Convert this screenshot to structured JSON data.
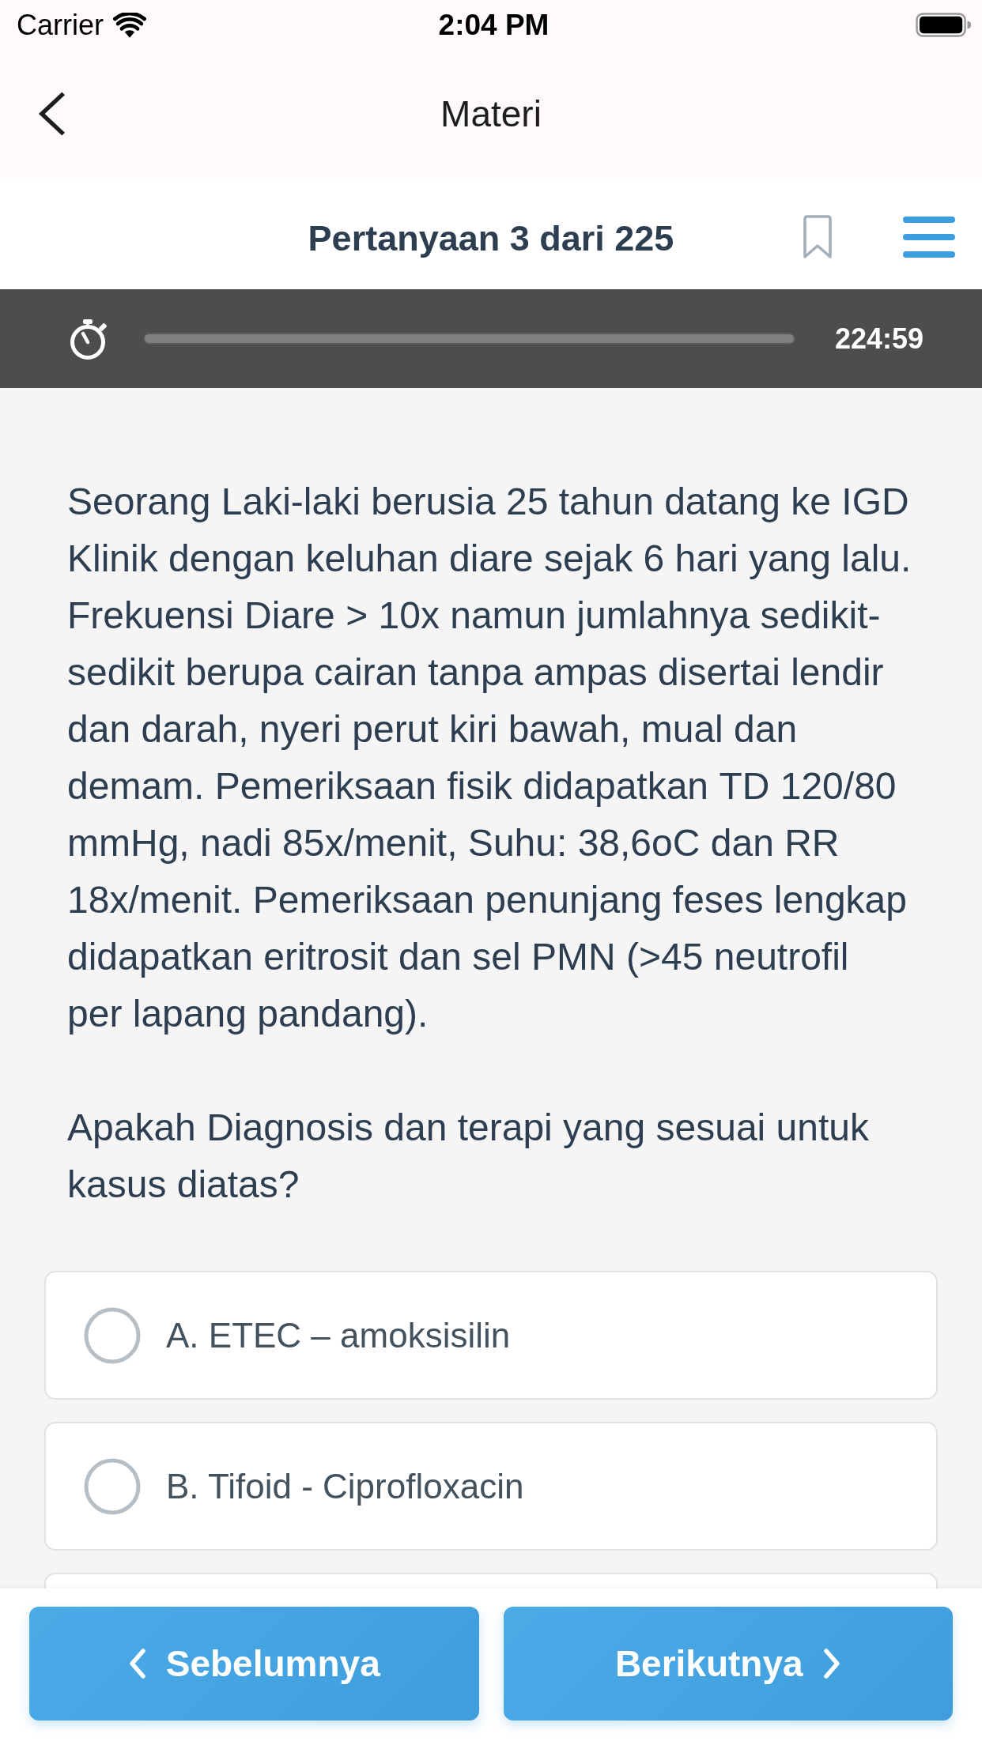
{
  "status_bar": {
    "carrier": "Carrier",
    "time": "2:04 PM"
  },
  "nav_bar": {
    "title": "Materi"
  },
  "question_header": {
    "title": "Pertanyaan 3 dari 225",
    "bookmarked": false
  },
  "timer": {
    "level": 1,
    "time": "224:59"
  },
  "question": {
    "case_text": "Seorang Laki-laki berusia 25 tahun datang ke IGD Klinik dengan keluhan diare sejak 6 hari yang lalu. Frekuensi Diare > 10x namun jumlahnya sedikit-sedikit berupa cairan tanpa ampas disertai lendir dan darah, nyeri perut kiri bawah, mual dan demam. Pemeriksaan fisik didapatkan TD 120/80 mmHg, nadi 85x/menit, Suhu: 38,6oC dan RR 18x/menit. Pemeriksaan penunjang feses lengkap didapatkan eritrosit dan sel PMN (>45 neutrofil per lapang pandang).",
    "prompt": "Apakah Diagnosis dan terapi yang sesuai untuk kasus diatas?"
  },
  "options": [
    {
      "label": "A. ETEC – amoksisilin",
      "selected": false
    },
    {
      "label": "B. Tifoid - Ciprofloxacin",
      "selected": false
    }
  ],
  "nav_buttons": [
    {
      "label": "Sebelumnya",
      "kind": "previous"
    },
    {
      "label": "Berikutnya",
      "kind": "next"
    }
  ]
}
